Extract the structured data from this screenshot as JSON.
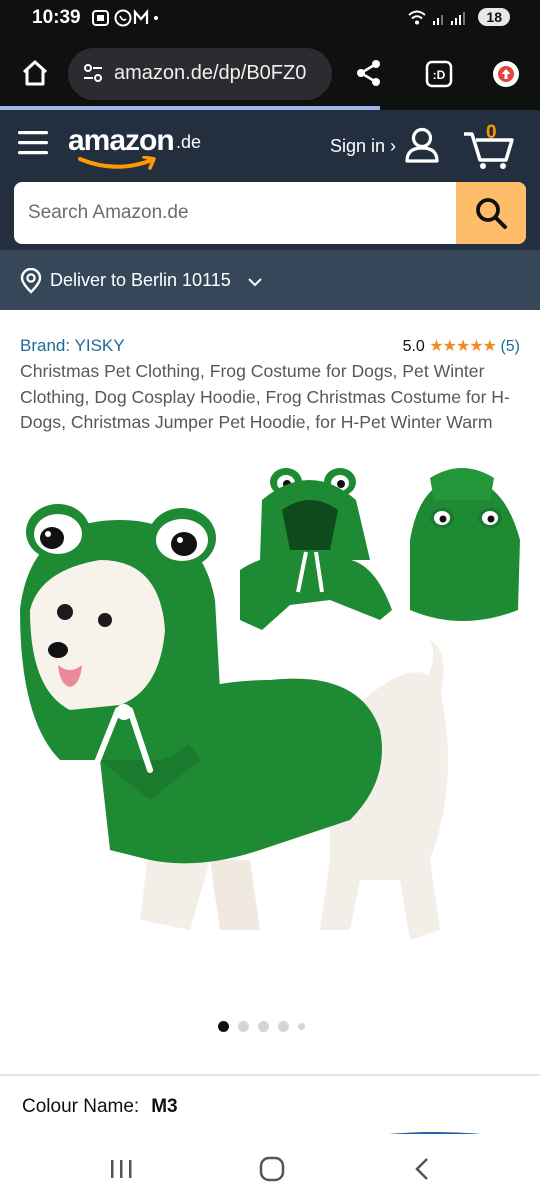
{
  "status_bar": {
    "time": "10:39",
    "left_icons": [
      "screenshot-icon",
      "whatsapp-icon",
      "gmail-icon",
      "dot"
    ],
    "battery": "18"
  },
  "browser": {
    "url": "amazon.de/dp/B0FZ0"
  },
  "amazon": {
    "logo_text": "amazon",
    "logo_tld": ".de",
    "sign_in": "Sign in ›",
    "cart_count": "0",
    "search_placeholder": "Search Amazon.de",
    "deliver_to": "Deliver to Berlin 10115"
  },
  "product": {
    "brand": "Brand: YISKY",
    "rating_value": "5.0",
    "stars": "★★★★★",
    "rating_count": "(5)",
    "title": "Christmas Pet Clothing, Frog Costume for Dogs, Pet Winter Clothing, Dog Cosplay Hoodie, Frog Christmas Costume for H-Dogs, Christmas Jumper Pet Hoodie, for H-Pet Winter Warm",
    "image_count": 5,
    "active_image": 1,
    "colour_label": "Colour Name:",
    "colour_value": "M3"
  },
  "colors": {
    "amazon_navy": "#232f3e",
    "deliver_bar": "#37475a",
    "search_button": "#febd69",
    "link_blue": "#1d6b94",
    "star_orange": "#f08a24",
    "hoodie_green": "#1f8a34"
  }
}
